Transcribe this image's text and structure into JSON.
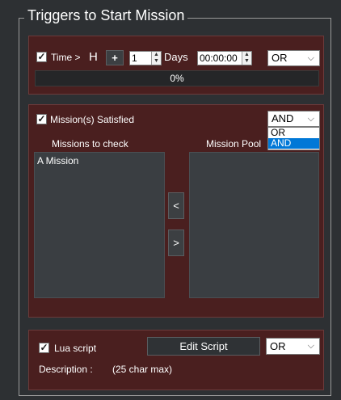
{
  "group": {
    "title": "Triggers to Start Mission"
  },
  "time_trigger": {
    "checkbox_label": "Time >",
    "unit_letter": "H",
    "plus_label": "+",
    "days_value": "1",
    "days_label": "Days",
    "time_value": "00:00:00",
    "logic_value": "OR",
    "progress_text": "0%",
    "progress_fraction": 0
  },
  "missions_trigger": {
    "checkbox_label": "Mission(s) Satisfied",
    "logic_value": "AND",
    "dropdown_options": [
      "OR",
      "AND"
    ],
    "selected_option": "AND",
    "left_header": "Missions to check",
    "right_header": "Mission Pool",
    "left_items": [
      "A Mission"
    ],
    "right_items": [],
    "move_left_label": "<",
    "move_right_label": ">"
  },
  "lua_trigger": {
    "checkbox_label": "Lua script",
    "edit_button_label": "Edit Script",
    "logic_value": "OR",
    "description_label": "Description :",
    "description_hint": "(25 char max)"
  },
  "icons": {
    "check": "✓",
    "chevron": "⌵",
    "spin_up": "▲",
    "spin_down": "▼"
  }
}
